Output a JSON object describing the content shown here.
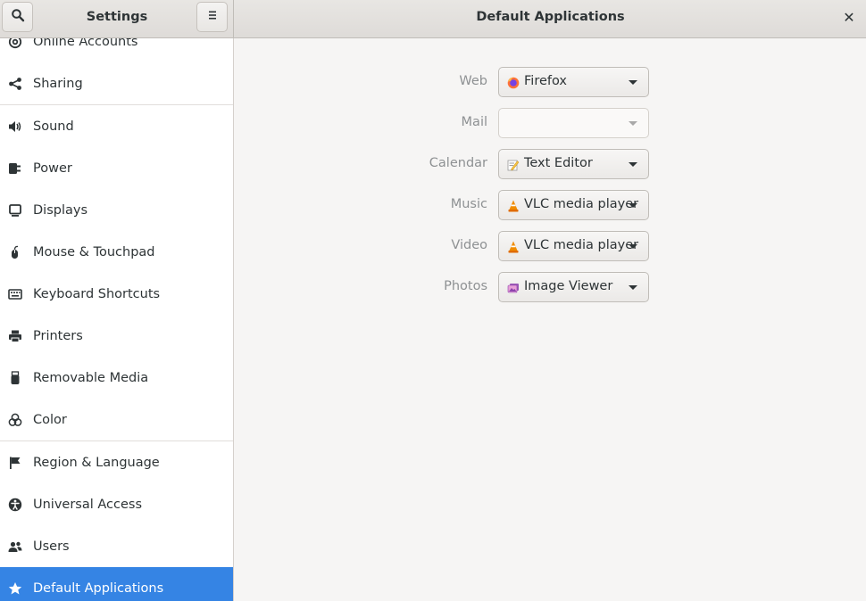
{
  "header": {
    "sidebar_title": "Settings",
    "panel_title": "Default Applications",
    "search_icon": "search-icon",
    "menu_icon": "hamburger-menu-icon",
    "close_icon": "close-icon",
    "close_glyph": "✕"
  },
  "sidebar": {
    "items": [
      {
        "label": "Online Accounts",
        "icon": "at-sign-icon"
      },
      {
        "label": "Sharing",
        "icon": "share-icon"
      },
      {
        "label": "Sound",
        "icon": "speaker-icon"
      },
      {
        "label": "Power",
        "icon": "power-plug-icon"
      },
      {
        "label": "Displays",
        "icon": "monitor-icon"
      },
      {
        "label": "Mouse & Touchpad",
        "icon": "mouse-icon"
      },
      {
        "label": "Keyboard Shortcuts",
        "icon": "keyboard-icon"
      },
      {
        "label": "Printers",
        "icon": "printer-icon"
      },
      {
        "label": "Removable Media",
        "icon": "usb-drive-icon"
      },
      {
        "label": "Color",
        "icon": "color-circles-icon"
      },
      {
        "label": "Region & Language",
        "icon": "flag-icon"
      },
      {
        "label": "Universal Access",
        "icon": "accessibility-icon"
      },
      {
        "label": "Users",
        "icon": "users-icon"
      },
      {
        "label": "Default Applications",
        "icon": "star-icon",
        "selected": true
      }
    ]
  },
  "defaults": [
    {
      "label": "Web",
      "value": "Firefox",
      "icon": "firefox-icon"
    },
    {
      "label": "Mail",
      "value": "",
      "icon": "",
      "disabled": true
    },
    {
      "label": "Calendar",
      "value": "Text Editor",
      "icon": "text-editor-icon"
    },
    {
      "label": "Music",
      "value": "VLC media player",
      "icon": "vlc-icon"
    },
    {
      "label": "Video",
      "value": "VLC media player",
      "icon": "vlc-icon"
    },
    {
      "label": "Photos",
      "value": "Image Viewer",
      "icon": "image-viewer-icon"
    }
  ],
  "colors": {
    "accent": "#3584e4",
    "sidebar_bg": "#ffffff",
    "window_bg": "#f6f5f4"
  }
}
